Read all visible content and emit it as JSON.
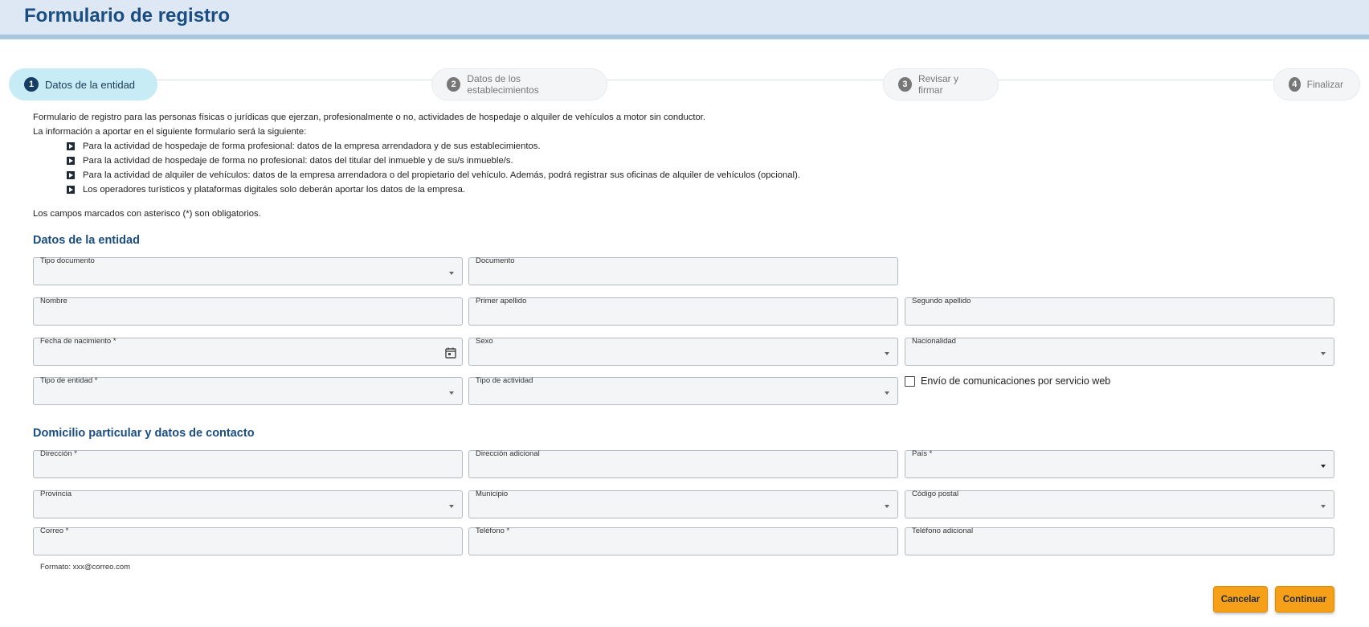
{
  "header": {
    "title": "Formulario de registro"
  },
  "stepper": {
    "steps": [
      {
        "number": "1",
        "label": "Datos de la entidad"
      },
      {
        "number": "2",
        "label": "Datos de los establecimientos"
      },
      {
        "number": "3",
        "label": "Revisar y firmar"
      },
      {
        "number": "4",
        "label": "Finalizar"
      }
    ]
  },
  "intro": {
    "line1": "Formulario de registro para las personas físicas o jurídicas que ejerzan, profesionalmente o no, actividades de hospedaje o alquiler de vehículos a motor sin conductor.",
    "line2": "La información a aportar en el siguiente formulario será la siguiente:",
    "bullets": [
      "Para la actividad de hospedaje de forma profesional: datos de la empresa arrendadora y de sus establecimientos.",
      "Para la actividad de hospedaje de forma no profesional: datos del titular del inmueble y de su/s inmueble/s.",
      "Para la actividad de alquiler de vehículos: datos de la empresa arrendadora o del propietario del vehículo. Además, podrá registrar sus oficinas de alquiler de vehículos (opcional).",
      "Los operadores turísticos y plataformas digitales solo deberán aportar los datos de la empresa."
    ],
    "required_note": "Los campos marcados con asterisco (*) son obligatorios."
  },
  "entity": {
    "title": "Datos de la entidad",
    "fields": {
      "tipo_documento": "Tipo documento",
      "documento": "Documento",
      "nombre": "Nombre",
      "primer_apellido": "Primer apellido",
      "segundo_apellido": "Segundo apellido",
      "fecha_nacimiento": "Fecha de nacimiento *",
      "sexo": "Sexo",
      "nacionalidad": "Nacionalidad",
      "tipo_entidad": "Tipo de entidad *",
      "tipo_actividad": "Tipo de actividad"
    },
    "checkbox_label": "Envío de comunicaciones por servicio web",
    "checkbox_checked": false
  },
  "contact": {
    "title": "Domicilio particular y datos de contacto",
    "fields": {
      "direccion": "Dirección *",
      "direccion_adicional": "Dirección adicional",
      "pais": "País *",
      "provincia": "Provincia",
      "municipio": "Municipio",
      "codigo_postal": "Código postal",
      "correo": "Correo *",
      "telefono": "Teléfono *",
      "telefono_adicional": "Teléfono adicional"
    },
    "email_hint": "Formato: xxx@correo.com"
  },
  "actions": {
    "cancel": "Cancelar",
    "continue": "Continuar"
  },
  "colors": {
    "accent": "#f6a01a",
    "title": "#1a4e82",
    "active_step": "#c8ecf6",
    "header_bg": "#dde8f4"
  },
  "icons": {
    "calendar": "calendar-icon",
    "dropdown": "chevron-down-icon",
    "bullet": "play-square-icon"
  }
}
